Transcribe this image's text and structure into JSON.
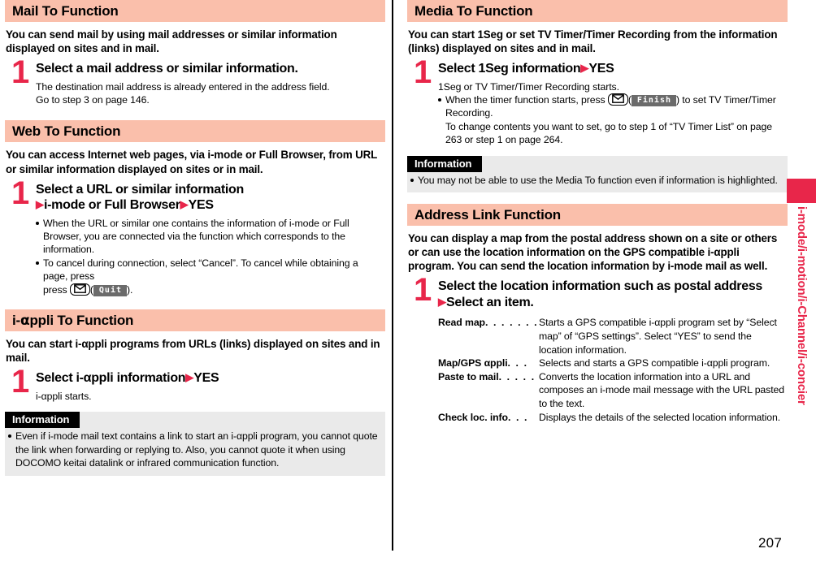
{
  "page": {
    "number": "207",
    "thumb_tab_label": "i-mode/i-motion/i-Channel/i-concier",
    "accent_color": "#e8264a",
    "section_header_color": "#fabfab",
    "info_box_color": "#eaeaea"
  },
  "left_column": {
    "sections": [
      {
        "title": "Mail To Function",
        "lead": "You can send mail by using mail addresses or similar information displayed on sites and in mail.",
        "step": {
          "number": "1",
          "title": "Select a mail address or similar information.",
          "body_lines": [
            "The destination mail address is already entered in the address field.",
            "Go to step 3 on page 146."
          ]
        }
      },
      {
        "title": "Web To Function",
        "lead": "You can access Internet web pages, via i-mode or Full Browser, from URL or similar information displayed on sites or in mail.",
        "step": {
          "number": "1",
          "title_line1": "Select a URL or similar information",
          "title_line2_a": "i-mode or Full Browser",
          "title_line2_b": "YES",
          "bullets": [
            "When the URL or similar one contains the information of i-mode or Full Browser, you are connected via the function which corresponds to the information.",
            "To cancel during connection, select “Cancel”. To cancel while obtaining a page, press"
          ],
          "quit_prefix": "press",
          "quit_key_icon": "mail-key-icon",
          "quit_softkey": "Quit",
          "quit_suffix": ")."
        }
      },
      {
        "title_prefix": "i-",
        "title_alpha": "α",
        "title_suffix": "ppli To Function",
        "title": "i-αppli To Function",
        "lead": "You can start i-αppli programs from URLs (links) displayed on sites and in mail.",
        "step": {
          "number": "1",
          "title_a": "Select i-αppli information",
          "title_b": "YES",
          "body_lines": [
            "i-αppli starts."
          ]
        },
        "information": {
          "tag": "Information",
          "bullets": [
            "Even if i-mode mail text contains a link to start an i-αppli program, you cannot quote the link when forwarding or replying to. Also, you cannot quote it when using DOCOMO keitai datalink or infrared communication function."
          ]
        }
      }
    ]
  },
  "right_column": {
    "sections": [
      {
        "title": "Media To Function",
        "lead": "You can start 1Seg or set TV Timer/Timer Recording from the information (links) displayed on sites and in mail.",
        "step": {
          "number": "1",
          "title_a": "Select 1Seg information",
          "title_b": "YES",
          "body_first_line": "1Seg or TV Timer/Timer Recording starts.",
          "bullet_prefix": "When the timer function starts, press",
          "bullet_key_icon": "mail-key-icon",
          "bullet_softkey": "Finish",
          "bullet_suffix": ") to set TV Timer/Timer Recording.",
          "sub_lines": [
            "To change contents you want to set, go to step 1 of “TV Timer List” on page 263 or step 1 on page 264."
          ]
        },
        "information": {
          "tag": "Information",
          "bullets": [
            "You may not be able to use the Media To function even if information is highlighted."
          ]
        }
      },
      {
        "title": "Address Link Function",
        "lead": "You can display a map from the postal address shown on a site or others or can use the location information on the GPS compatible i-αppli program. You can send the location information by i-mode mail as well.",
        "step": {
          "number": "1",
          "title_line1": "Select the location information such as postal address",
          "title_line2": "Select an item."
        },
        "definitions": [
          {
            "term": "Read map",
            "dots": ". . . . . . .",
            "desc": "Starts a GPS compatible i-αppli program set by “Select map” of “GPS settings”. Select “YES” to send the location information."
          },
          {
            "term": "Map/GPS αppli",
            "dots": ". . .",
            "desc": "Selects and starts a GPS compatible i-αppli program."
          },
          {
            "term": "Paste to mail",
            "dots": ". . . . .",
            "desc": "Converts the location information into a URL and composes an i-mode mail message with the URL pasted to the text."
          },
          {
            "term": "Check loc. info",
            "dots": ". . .",
            "desc": "Displays the details of the selected location information."
          }
        ]
      }
    ]
  }
}
